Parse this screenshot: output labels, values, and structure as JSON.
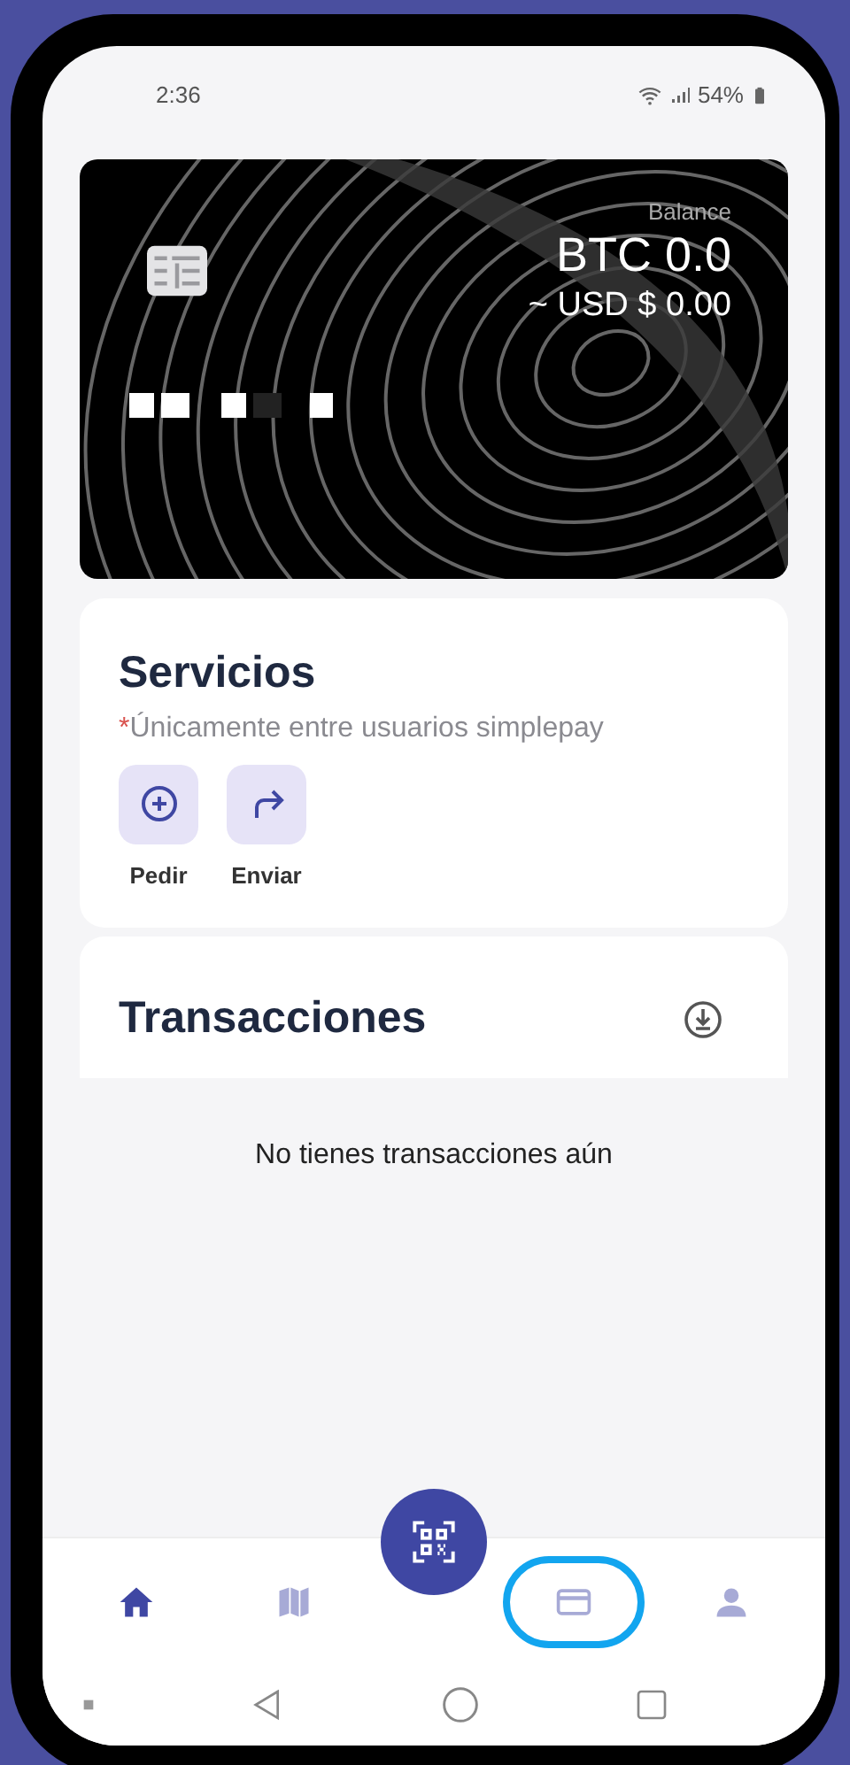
{
  "status_bar": {
    "time": "2:36",
    "battery": "54%"
  },
  "balance_card": {
    "label": "Balance",
    "crypto": "BTC 0.0",
    "fiat": "~ USD $ 0.00"
  },
  "services": {
    "title": "Servicios",
    "note_mark": "*",
    "note": "Únicamente entre usuarios simplepay",
    "actions": [
      {
        "label": "Pedir",
        "kind": "plus"
      },
      {
        "label": "Enviar",
        "kind": "send"
      }
    ]
  },
  "transactions": {
    "title": "Transacciones",
    "empty_message": "No tienes transacciones aún"
  },
  "bottom_nav": [
    {
      "kind": "home",
      "selected": true,
      "highlighted": false
    },
    {
      "kind": "map",
      "selected": false,
      "highlighted": false
    },
    {
      "kind": "card",
      "selected": false,
      "highlighted": true
    },
    {
      "kind": "profile",
      "selected": false,
      "highlighted": false
    }
  ]
}
